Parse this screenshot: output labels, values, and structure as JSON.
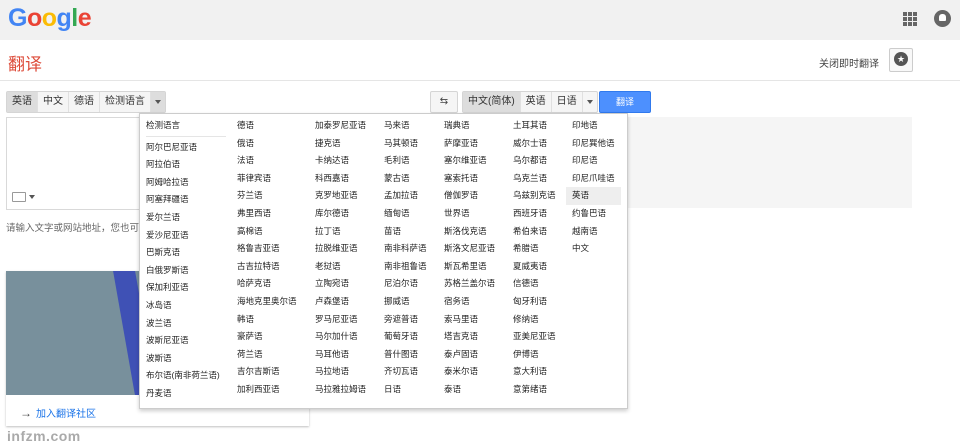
{
  "header": {
    "logo": "Google"
  },
  "colors": {
    "accent_red": "#dd4b39",
    "button_blue": "#4d90fe",
    "link_blue": "#1a73e8"
  },
  "subheader": {
    "title": "翻译",
    "instant_toggle": "关闭即时翻译"
  },
  "source_langs": [
    "英语",
    "中文",
    "德语",
    "检测语言"
  ],
  "target_langs": [
    "中文(简体)",
    "英语",
    "日语"
  ],
  "translate_label": "翻译",
  "hint": "请输入文字或网站地址，您也可以",
  "promo_link": "加入翻译社区",
  "watermark": "infzm.com",
  "dropdown": {
    "columns": [
      [
        "检测语言",
        "阿尔巴尼亚语",
        "阿拉伯语",
        "阿姆哈拉语",
        "阿塞拜疆语",
        "爱尔兰语",
        "爱沙尼亚语",
        "巴斯克语",
        "白俄罗斯语",
        "保加利亚语",
        "冰岛语",
        "波兰语",
        "波斯尼亚语",
        "波斯语",
        "布尔语(南非荷兰语)",
        "丹麦语"
      ],
      [
        "德语",
        "俄语",
        "法语",
        "菲律宾语",
        "芬兰语",
        "弗里西语",
        "高棉语",
        "格鲁吉亚语",
        "古吉拉特语",
        "哈萨克语",
        "海地克里奥尔语",
        "韩语",
        "豪萨语",
        "荷兰语",
        "吉尔吉斯语",
        "加利西亚语"
      ],
      [
        "加泰罗尼亚语",
        "捷克语",
        "卡纳达语",
        "科西嘉语",
        "克罗地亚语",
        "库尔德语",
        "拉丁语",
        "拉脱维亚语",
        "老挝语",
        "立陶宛语",
        "卢森堡语",
        "罗马尼亚语",
        "马尔加什语",
        "马耳他语",
        "马拉地语",
        "马拉雅拉姆语"
      ],
      [
        "马来语",
        "马其顿语",
        "毛利语",
        "蒙古语",
        "孟加拉语",
        "缅甸语",
        "苗语",
        "南非科萨语",
        "南非祖鲁语",
        "尼泊尔语",
        "挪威语",
        "旁遮普语",
        "葡萄牙语",
        "普什图语",
        "齐切瓦语",
        "日语"
      ],
      [
        "瑞典语",
        "萨摩亚语",
        "塞尔维亚语",
        "塞索托语",
        "僧伽罗语",
        "世界语",
        "斯洛伐克语",
        "斯洛文尼亚语",
        "斯瓦希里语",
        "苏格兰盖尔语",
        "宿务语",
        "索马里语",
        "塔吉克语",
        "泰卢固语",
        "泰米尔语",
        "泰语"
      ],
      [
        "土耳其语",
        "威尔士语",
        "乌尔都语",
        "乌克兰语",
        "乌兹别克语",
        "西班牙语",
        "希伯来语",
        "希腊语",
        "夏威夷语",
        "信德语",
        "匈牙利语",
        "修纳语",
        "亚美尼亚语",
        "伊博语",
        "意大利语",
        "意第绪语"
      ],
      [
        "印地语",
        "印尼巽他语",
        "印尼语",
        "印尼爪哇语",
        "英语",
        "约鲁巴语",
        "越南语",
        "中文"
      ]
    ],
    "selected": "英语"
  }
}
